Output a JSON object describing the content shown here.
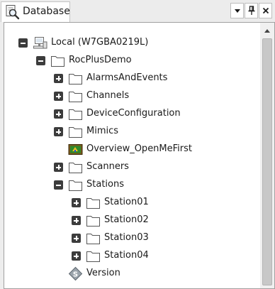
{
  "panel": {
    "title": "Database",
    "buttons": [
      "dropdown-icon",
      "pin-icon",
      "close-icon"
    ]
  },
  "tree": [
    {
      "label": "Local (W7GBA0219L)",
      "level": 0,
      "expander": "expanded",
      "icon": "computer-icon"
    },
    {
      "label": "RocPlusDemo",
      "level": 1,
      "expander": "expanded",
      "icon": "folder-icon"
    },
    {
      "label": "AlarmsAndEvents",
      "level": 2,
      "expander": "collapsed",
      "icon": "folder-icon"
    },
    {
      "label": "Channels",
      "level": 2,
      "expander": "collapsed",
      "icon": "folder-icon"
    },
    {
      "label": "DeviceConfiguration",
      "level": 2,
      "expander": "collapsed",
      "icon": "folder-icon"
    },
    {
      "label": "Mimics",
      "level": 2,
      "expander": "collapsed",
      "icon": "folder-icon"
    },
    {
      "label": "Overview_OpenMeFirst",
      "level": 2,
      "expander": "none",
      "icon": "mimic-icon"
    },
    {
      "label": "Scanners",
      "level": 2,
      "expander": "collapsed",
      "icon": "folder-icon"
    },
    {
      "label": "Stations",
      "level": 2,
      "expander": "expanded",
      "icon": "folder-icon"
    },
    {
      "label": "Station01",
      "level": 3,
      "expander": "collapsed",
      "icon": "folder-icon"
    },
    {
      "label": "Station02",
      "level": 3,
      "expander": "collapsed",
      "icon": "folder-icon"
    },
    {
      "label": "Station03",
      "level": 3,
      "expander": "collapsed",
      "icon": "folder-icon"
    },
    {
      "label": "Station04",
      "level": 3,
      "expander": "collapsed",
      "icon": "folder-icon"
    },
    {
      "label": "Version",
      "level": 2,
      "expander": "none",
      "icon": "version-icon"
    }
  ]
}
